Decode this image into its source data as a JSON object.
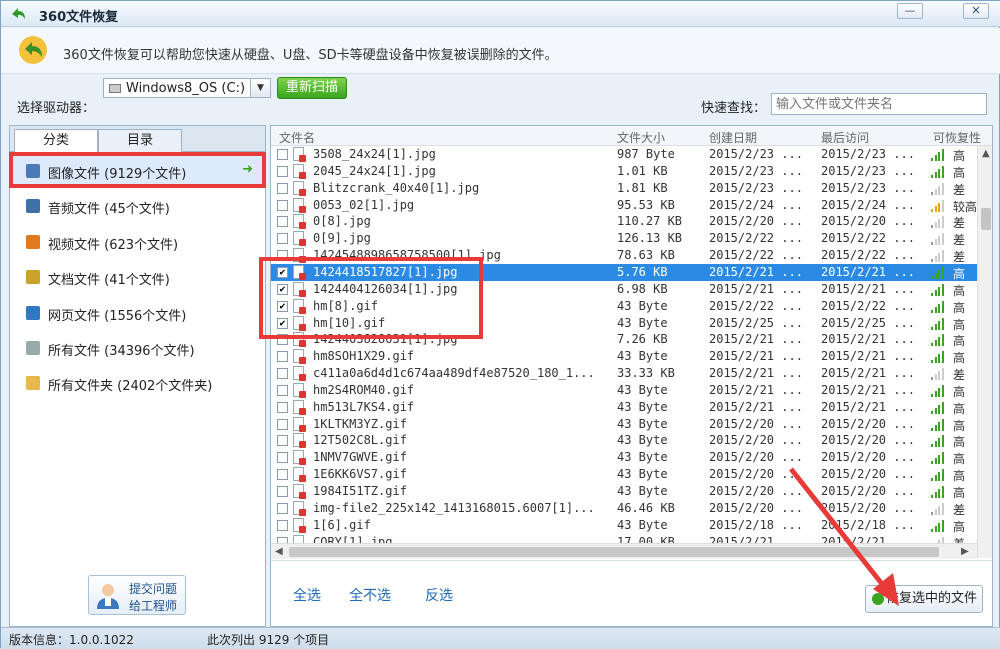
{
  "window": {
    "title": "360文件恢复",
    "min_label": "—",
    "close_label": "✕"
  },
  "banner": {
    "description": "360文件恢复可以帮助您快速从硬盘、U盘、SD卡等硬盘设备中恢复被误删除的文件。"
  },
  "drive": {
    "label": "选择驱动器：",
    "selected": "Windows8_OS (C:)",
    "rescan_label": "重新扫描"
  },
  "quick_search": {
    "label": "快速查找：",
    "placeholder": "输入文件或文件夹名"
  },
  "tabs": [
    {
      "label": "分类"
    },
    {
      "label": "目录"
    }
  ],
  "categories": [
    {
      "label": "图像文件 (9129个文件)",
      "icon": "image-icon",
      "color": "#4a7bb7"
    },
    {
      "label": "音频文件 (45个文件)",
      "icon": "music-icon",
      "color": "#3d6fa8"
    },
    {
      "label": "视频文件 (623个文件)",
      "icon": "video-icon",
      "color": "#e07a1f"
    },
    {
      "label": "文档文件 (41个文件)",
      "icon": "document-icon",
      "color": "#c9a227"
    },
    {
      "label": "网页文件 (1556个文件)",
      "icon": "web-icon",
      "color": "#2f78c4"
    },
    {
      "label": "所有文件 (34396个文件)",
      "icon": "file-icon",
      "color": "#9aa"
    },
    {
      "label": "所有文件夹 (2402个文件夹)",
      "icon": "folder-icon",
      "color": "#e8b84a"
    }
  ],
  "engineer_button": {
    "line1": "提交问题",
    "line2": "给工程师"
  },
  "table": {
    "headers": {
      "name": "文件名",
      "size": "文件大小",
      "created": "创建日期",
      "accessed": "最后访问",
      "recover": "可恢复性"
    },
    "rows": [
      {
        "name": "3508_24x24[1].jpg",
        "size": "987 Byte",
        "created": "2015/2/23 ...",
        "accessed": "2015/2/23 ...",
        "recover": "高",
        "checked": false
      },
      {
        "name": "2045_24x24[1].jpg",
        "size": "1.01 KB",
        "created": "2015/2/23 ...",
        "accessed": "2015/2/23 ...",
        "recover": "高",
        "checked": false
      },
      {
        "name": "Blitzcrank_40x40[1].jpg",
        "size": "1.81 KB",
        "created": "2015/2/23 ...",
        "accessed": "2015/2/23 ...",
        "recover": "差",
        "checked": false
      },
      {
        "name": "0053_02[1].jpg",
        "size": "95.53 KB",
        "created": "2015/2/24 ...",
        "accessed": "2015/2/24 ...",
        "recover": "较高",
        "checked": false
      },
      {
        "name": "0[8].jpg",
        "size": "110.27 KB",
        "created": "2015/2/20 ...",
        "accessed": "2015/2/20 ...",
        "recover": "差",
        "checked": false
      },
      {
        "name": "0[9].jpg",
        "size": "126.13 KB",
        "created": "2015/2/22 ...",
        "accessed": "2015/2/22 ...",
        "recover": "差",
        "checked": false
      },
      {
        "name": "1424548898658758500[1].jpg",
        "size": "78.63 KB",
        "created": "2015/2/22 ...",
        "accessed": "2015/2/22 ...",
        "recover": "差",
        "checked": false
      },
      {
        "name": "1424418517827[1].jpg",
        "size": "5.76 KB",
        "created": "2015/2/21 ...",
        "accessed": "2015/2/21 ...",
        "recover": "高",
        "checked": true
      },
      {
        "name": "1424404126034[1].jpg",
        "size": "6.98 KB",
        "created": "2015/2/21 ...",
        "accessed": "2015/2/21 ...",
        "recover": "高",
        "checked": true
      },
      {
        "name": "hm[8].gif",
        "size": "43 Byte",
        "created": "2015/2/22 ...",
        "accessed": "2015/2/22 ...",
        "recover": "高",
        "checked": true
      },
      {
        "name": "hm[10].gif",
        "size": "43 Byte",
        "created": "2015/2/25 ...",
        "accessed": "2015/2/25 ...",
        "recover": "高",
        "checked": true
      },
      {
        "name": "1424403828031[1].jpg",
        "size": "7.26 KB",
        "created": "2015/2/21 ...",
        "accessed": "2015/2/21 ...",
        "recover": "高",
        "checked": false
      },
      {
        "name": "hm8SOH1X29.gif",
        "size": "43 Byte",
        "created": "2015/2/21 ...",
        "accessed": "2015/2/21 ...",
        "recover": "高",
        "checked": false
      },
      {
        "name": "c411a0a6d4d1c674aa489df4e87520_180_1...",
        "size": "33.33 KB",
        "created": "2015/2/21 ...",
        "accessed": "2015/2/21 ...",
        "recover": "差",
        "checked": false
      },
      {
        "name": "hm2S4ROM40.gif",
        "size": "43 Byte",
        "created": "2015/2/21 ...",
        "accessed": "2015/2/21 ...",
        "recover": "高",
        "checked": false
      },
      {
        "name": "hm513L7KS4.gif",
        "size": "43 Byte",
        "created": "2015/2/21 ...",
        "accessed": "2015/2/21 ...",
        "recover": "高",
        "checked": false
      },
      {
        "name": "1KLTKM3YZ.gif",
        "size": "43 Byte",
        "created": "2015/2/20 ...",
        "accessed": "2015/2/20 ...",
        "recover": "高",
        "checked": false
      },
      {
        "name": "12T502C8L.gif",
        "size": "43 Byte",
        "created": "2015/2/20 ...",
        "accessed": "2015/2/20 ...",
        "recover": "高",
        "checked": false
      },
      {
        "name": "1NMV7GWVE.gif",
        "size": "43 Byte",
        "created": "2015/2/20 ...",
        "accessed": "2015/2/20 ...",
        "recover": "高",
        "checked": false
      },
      {
        "name": "1E6KK6VS7.gif",
        "size": "43 Byte",
        "created": "2015/2/20 ...",
        "accessed": "2015/2/20 ...",
        "recover": "高",
        "checked": false
      },
      {
        "name": "1984I51TZ.gif",
        "size": "43 Byte",
        "created": "2015/2/20 ...",
        "accessed": "2015/2/20 ...",
        "recover": "高",
        "checked": false
      },
      {
        "name": "img-file2_225x142_1413168015.6007[1]...",
        "size": "46.46 KB",
        "created": "2015/2/20 ...",
        "accessed": "2015/2/20 ...",
        "recover": "差",
        "checked": false
      },
      {
        "name": "1[6].gif",
        "size": "43 Byte",
        "created": "2015/2/18 ...",
        "accessed": "2015/2/18 ...",
        "recover": "高",
        "checked": false
      },
      {
        "name": "CORY[1].jpg",
        "size": "17.00 KB",
        "created": "2015/2/21 ...",
        "accessed": "2015/2/21 ...",
        "recover": "差",
        "checked": false
      }
    ]
  },
  "actions": {
    "select_all": "全选",
    "select_none": "全不选",
    "invert": "反选",
    "recover": "恢复选中的文件"
  },
  "status": {
    "version": "版本信息：1.0.0.1022",
    "count": "此次列出 9129 个项目"
  },
  "colors": {
    "highlight": "#2a8ae4",
    "annotation_red": "#e93a3a",
    "accent_green": "#3aa41f"
  }
}
